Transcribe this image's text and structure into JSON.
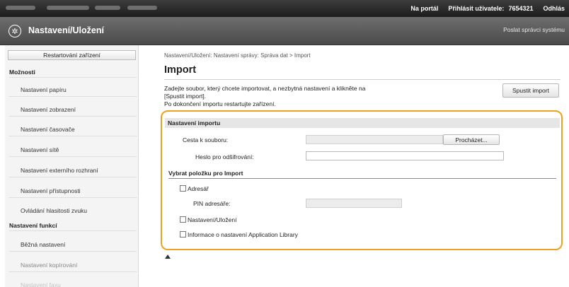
{
  "topbar": {
    "portal": "Na portál",
    "login_label": "Přihlásit uživatele:",
    "user_id": "7654321",
    "logout": "Odhlás"
  },
  "header": {
    "title": "Nastavení/Uložení",
    "admin_mail": "Poslat správci systému"
  },
  "sidebar": {
    "restart_button": "Restartování zařízení",
    "section1": "Možnosti",
    "items1": [
      "Nastavení papíru",
      "Nastavení zobrazení",
      "Nastavení časovače",
      "Nastavení sítě",
      "Nastavení externího rozhraní",
      "Nastavení přístupnosti",
      "Ovládání hlasitosti zvuku"
    ],
    "section2": "Nastavení funkcí",
    "items2": [
      "Běžná nastavení",
      "Nastavení kopírování",
      "Nastavení faxu"
    ]
  },
  "main": {
    "breadcrumb": "Nastavení/Uložení: Nastavení správy: Správa dat > Import",
    "title": "Import",
    "desc_line1": "Zadejte soubor, který chcete importovat, a nezbytná nastavení a klikněte na",
    "desc_line2": "[Spustit import].",
    "desc_line3": "Po dokončení importu restartujte zařízení.",
    "start_button": "Spustit import"
  },
  "import_settings": {
    "heading": "Nastavení importu",
    "file_path_label": "Cesta k souboru:",
    "file_path_value": "",
    "browse_button": "Procházet...",
    "password_label": "Heslo pro odšifrování:",
    "password_value": "",
    "select_heading": "Vybrat položku pro Import",
    "options": {
      "address_book": "Adresář",
      "pin_label": "PIN adresáře:",
      "settings": "Nastavení/Uložení",
      "app_library": "Informace o nastavení Application Library"
    }
  }
}
